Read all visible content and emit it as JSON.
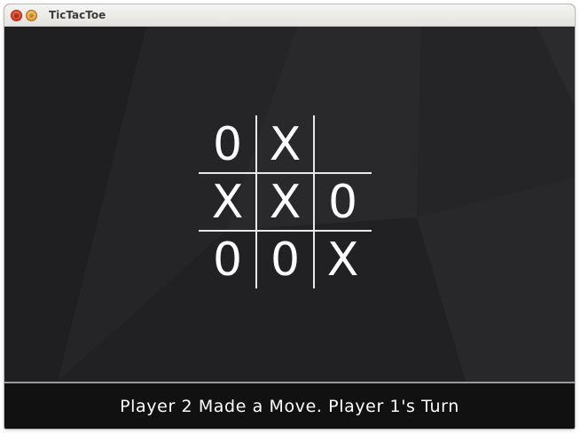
{
  "window": {
    "title": "TicTacToe"
  },
  "board": {
    "cells": [
      [
        "0",
        "X",
        ""
      ],
      [
        "X",
        "X",
        "0"
      ],
      [
        "0",
        "0",
        "X"
      ]
    ]
  },
  "status": {
    "message": "Player 2 Made a Move. Player 1's Turn"
  },
  "colors": {
    "background": "#222224",
    "grid": "#e8e8e8",
    "mark": "#ffffff",
    "status_bar": "#111112"
  }
}
